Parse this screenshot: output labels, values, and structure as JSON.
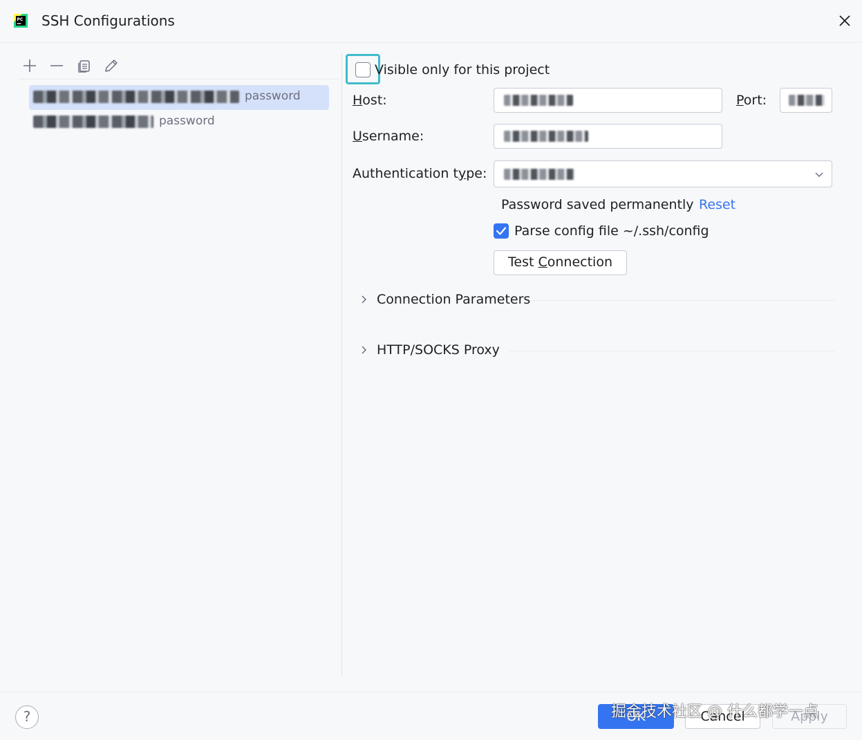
{
  "window": {
    "title": "SSH Configurations",
    "app_icon": "pycharm-logo",
    "close_icon": "close-icon"
  },
  "toolbar": {
    "icons": [
      "plus-icon",
      "minus-icon",
      "copy-icon",
      "edit-icon"
    ]
  },
  "configurations": [
    {
      "name": "",
      "auth": "password",
      "selected": true
    },
    {
      "name": "",
      "auth": "password",
      "selected": false
    }
  ],
  "form": {
    "visible_only_label": "isible only for this project",
    "visible_only_prefix": "V",
    "visible_only_checked": false,
    "host_label_u": "H",
    "host_label_rest": "ost:",
    "host_value": "",
    "port_label_u": "P",
    "port_label_rest": "ort:",
    "port_value": "",
    "username_label_u": "U",
    "username_label_rest": "sername:",
    "username_value": "",
    "auth_type_label_pre": "Authentication t",
    "auth_type_label_u": "y",
    "auth_type_label_post": "pe:",
    "auth_type_value": "",
    "password_saved_text": "Password saved permanently",
    "reset_link": "Reset",
    "parse_config_label": "Parse config file ~/.ssh/config",
    "parse_config_checked": true,
    "test_connection_pre": "Test ",
    "test_connection_u": "C",
    "test_connection_post": "onnection"
  },
  "sections": [
    {
      "label": "Connection Parameters",
      "expanded": false
    },
    {
      "label": "HTTP/SOCKS Proxy",
      "expanded": false
    }
  ],
  "footer": {
    "help_label": "?",
    "ok_label": "OK",
    "cancel_label": "Cancel",
    "apply_label": "Apply"
  },
  "watermark": "掘金技术社区 @ 什么都学一点",
  "colors": {
    "accent": "#3574f0",
    "selection": "#d5e1fb",
    "focus_ring": "#3fbccd"
  }
}
